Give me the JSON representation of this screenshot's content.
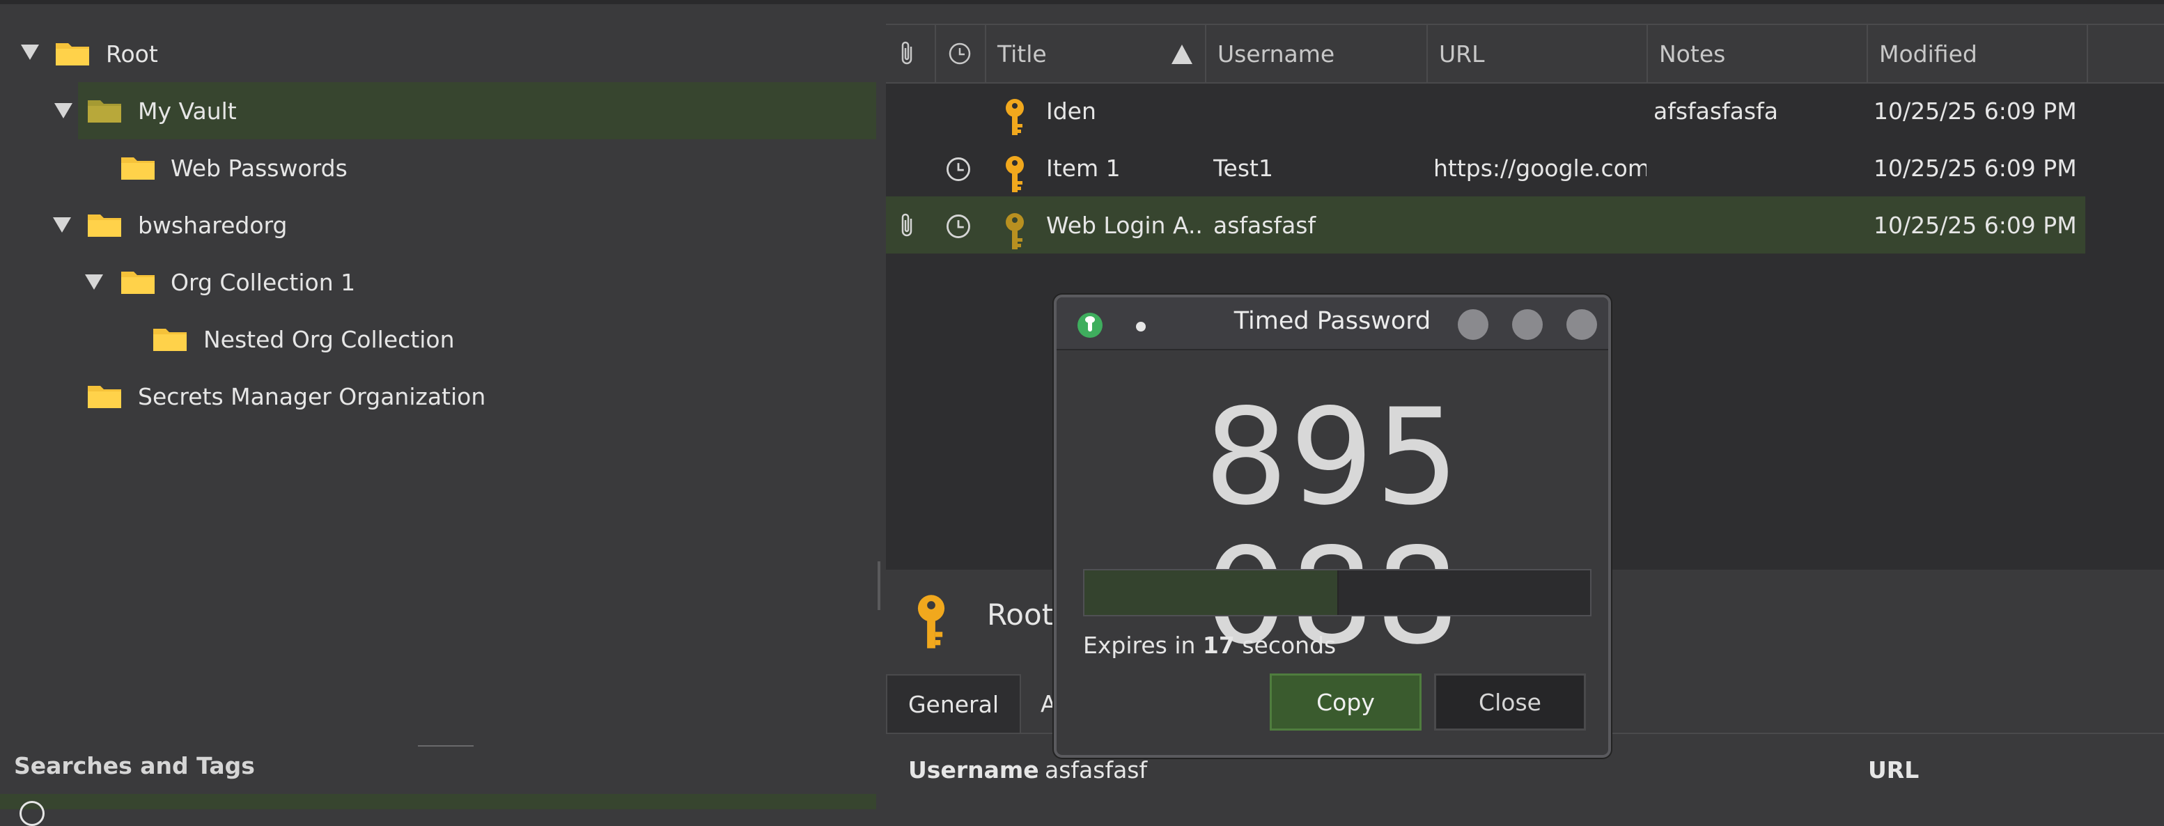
{
  "tree": {
    "items": [
      {
        "label": "Root"
      },
      {
        "label": "My Vault"
      },
      {
        "label": "Web Passwords"
      },
      {
        "label": "bwsharedorg"
      },
      {
        "label": "Org Collection 1"
      },
      {
        "label": "Nested Org Collection"
      },
      {
        "label": "Secrets Manager Organization"
      }
    ],
    "searches_label": "Searches and Tags"
  },
  "table": {
    "headers": [
      "Title",
      "Username",
      "URL",
      "Notes",
      "Modified"
    ],
    "rows": [
      {
        "title": "Iden",
        "username": "",
        "url": "",
        "notes": "afsfasfasfa",
        "modified": "10/25/25 6:09 PM"
      },
      {
        "title": "Item 1",
        "username": "Test1",
        "url": "https://google.com",
        "notes": "",
        "modified": "10/25/25 6:09 PM"
      },
      {
        "title": "Web Login A...",
        "username": "asfasfasf",
        "url": "",
        "notes": "",
        "modified": "10/25/25 6:09 PM"
      }
    ]
  },
  "detail": {
    "title": "Root",
    "tabs": [
      "General",
      "A"
    ],
    "username_label": "Username",
    "username_value": "asfasfasf",
    "url_label": "URL"
  },
  "dialog": {
    "title": "Timed Password",
    "code": "895 088",
    "progress_fraction": 0.5,
    "expires_prefix": "Expires in ",
    "expires_seconds": "17",
    "expires_suffix": " seconds",
    "copy_label": "Copy",
    "close_label": "Close"
  },
  "colors": {
    "selection": "#37452f",
    "folder": "#f5c23a",
    "key": "#f1a81d",
    "accent_green": "#3a5b2e"
  }
}
